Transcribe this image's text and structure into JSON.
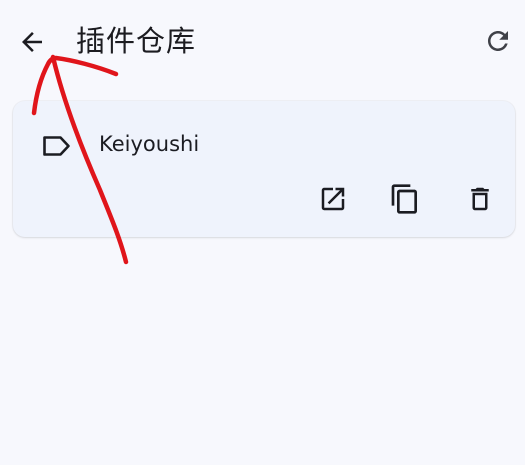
{
  "header": {
    "title": "插件仓库",
    "back_icon": "arrow-left-icon",
    "refresh_icon": "refresh-icon"
  },
  "plugins": [
    {
      "name": "Keiyoushi",
      "icon": "tag-icon",
      "actions": [
        "open-external-icon",
        "copy-icon",
        "delete-icon"
      ]
    }
  ],
  "colors": {
    "background": "#f7f8fd",
    "card": "#eff3fc",
    "text": "#1b1c20",
    "annotation": "#e0151b"
  }
}
